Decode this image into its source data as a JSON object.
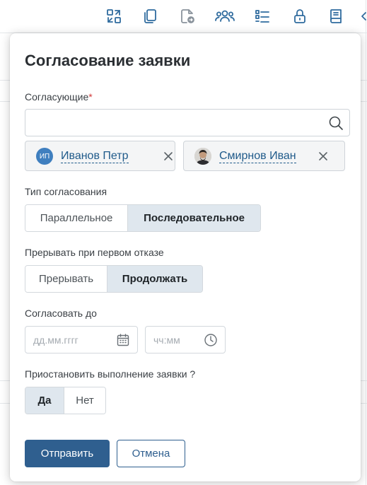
{
  "toolbar": {
    "icons": [
      "convert-icon",
      "copy-icon",
      "document-approval-icon",
      "users-group-icon",
      "checklist-icon",
      "lock-icon",
      "book-icon",
      "chevron-left-icon"
    ]
  },
  "dialog": {
    "title": "Согласование заявки",
    "approvers": {
      "label": "Согласующие",
      "required_mark": "*",
      "search_placeholder": "",
      "chips": [
        {
          "name": "Иванов Петр",
          "initials": "ИП",
          "avatar_type": "initials"
        },
        {
          "name": "Смирнов Иван",
          "initials": "",
          "avatar_type": "photo"
        }
      ]
    },
    "approval_type": {
      "label": "Тип согласования",
      "options": [
        "Параллельное",
        "Последовательное"
      ],
      "selected": "Последовательное"
    },
    "interrupt": {
      "label": "Прерывать при первом отказе",
      "options": [
        "Прерывать",
        "Продолжать"
      ],
      "selected": "Продолжать"
    },
    "deadline": {
      "label": "Согласовать до",
      "date_placeholder": "дд.мм.гггг",
      "time_placeholder": "чч:мм"
    },
    "suspend": {
      "label": "Приостановить выполнение заявки ?",
      "options": [
        "Да",
        "Нет"
      ],
      "selected": "Да"
    },
    "actions": {
      "submit": "Отправить",
      "cancel": "Отмена"
    }
  },
  "colors": {
    "primary": "#2f5f8f",
    "link": "#1f5a8a",
    "required": "#d23b3b",
    "active_segment": "#dfe7ee",
    "icon": "#2f6b9e"
  }
}
